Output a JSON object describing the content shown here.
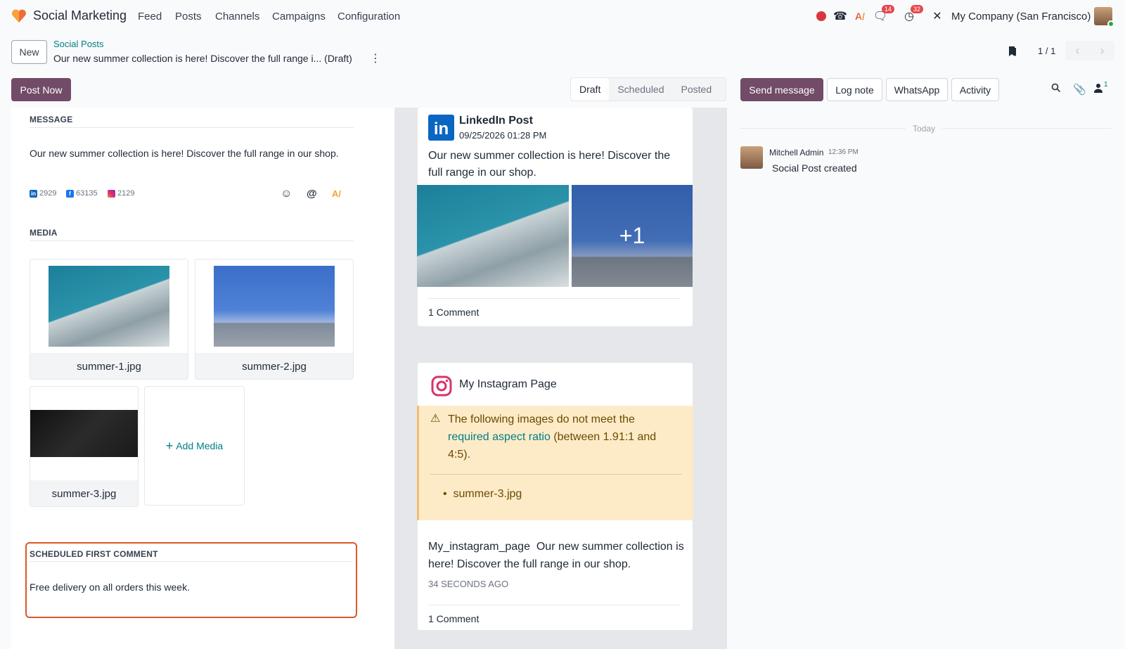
{
  "app": {
    "title": "Social Marketing"
  },
  "nav": [
    "Feed",
    "Posts",
    "Channels",
    "Campaigns",
    "Configuration"
  ],
  "systray": {
    "messages_badge": "14",
    "activities_badge": "32",
    "company": "My Company (San Francisco)"
  },
  "control": {
    "new_label": "New",
    "breadcrumb_parent": "Social Posts",
    "record_title": "Our new summer collection is here! Discover the full range i... (Draft)",
    "pager": "1 / 1",
    "post_now_label": "Post Now",
    "statuses": [
      "Draft",
      "Scheduled",
      "Posted"
    ],
    "active_status": "Draft"
  },
  "form": {
    "message_label": "MESSAGE",
    "message_text": "Our new summer collection is here! Discover the full range in our shop.",
    "counts": {
      "linkedin": "2929",
      "facebook": "63135",
      "instagram": "2129"
    },
    "media_label": "MEDIA",
    "media": [
      {
        "name": "summer-1.jpg"
      },
      {
        "name": "summer-2.jpg"
      },
      {
        "name": "summer-3.jpg"
      }
    ],
    "add_media_label": "Add Media",
    "first_comment_label": "SCHEDULED FIRST COMMENT",
    "first_comment_text": "Free delivery on all orders this week."
  },
  "preview": {
    "linkedin": {
      "title": "LinkedIn Post",
      "date": "09/25/2026 01:28 PM",
      "text": "Our new summer collection is here! Discover the full range in our shop.",
      "more_images": "+1",
      "comments": "1 Comment"
    },
    "instagram": {
      "title": "My Instagram Page",
      "warning_pre": "The following images do not meet the",
      "warning_link": "required aspect ratio",
      "warning_post": "(between 1.91:1 and 4:5).",
      "warning_item": "summer-3.jpg",
      "account": "My_instagram_page",
      "text": "Our new summer collection is here! Discover the full range in our shop.",
      "time": "34 SECONDS AGO",
      "comments": "1 Comment"
    }
  },
  "chatter": {
    "send_message": "Send message",
    "log_note": "Log note",
    "whatsapp": "WhatsApp",
    "activity": "Activity",
    "followers_count": "1",
    "date_separator": "Today",
    "message": {
      "author": "Mitchell Admin",
      "time": "12:36 PM",
      "body": "Social Post created"
    }
  },
  "colors": {
    "primary": "#714b67",
    "link": "#017e84",
    "warning_bg": "#fdebc8",
    "highlight_border": "#d9582b"
  }
}
